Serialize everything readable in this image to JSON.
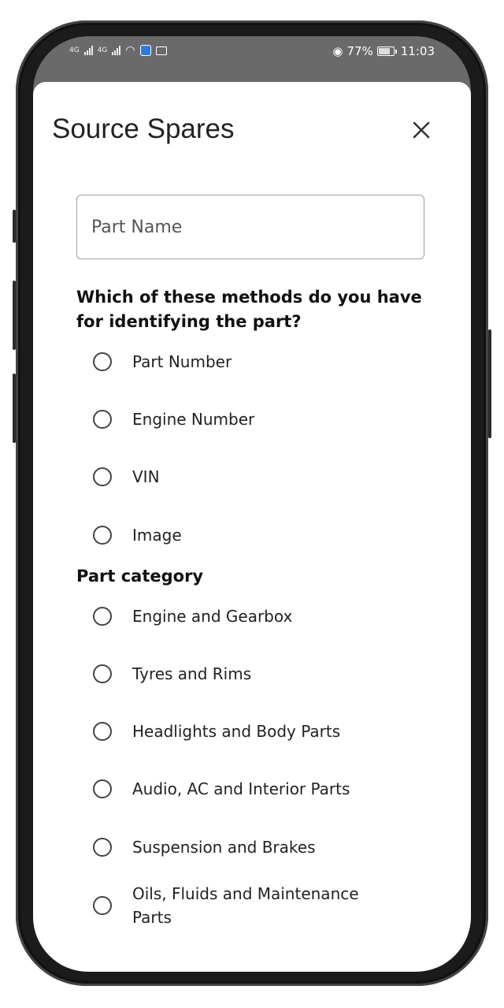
{
  "status_bar": {
    "network_1": "4G",
    "network_2": "4G",
    "battery": "77%",
    "time": "11:03"
  },
  "sheet": {
    "title": "Source Spares",
    "close_icon": "close-icon"
  },
  "form": {
    "part_name_placeholder": "Part Name",
    "identification_heading": "Which of these methods do you have for identifying the part?",
    "identification_options": [
      "Part Number",
      "Engine Number",
      "VIN",
      "Image"
    ],
    "category_heading": "Part category",
    "category_options": [
      "Engine and Gearbox",
      "Tyres and Rims",
      "Headlights and Body Parts",
      "Audio, AC and Interior Parts",
      "Suspension and Brakes",
      "Oils, Fluids and Maintenance Parts"
    ]
  }
}
